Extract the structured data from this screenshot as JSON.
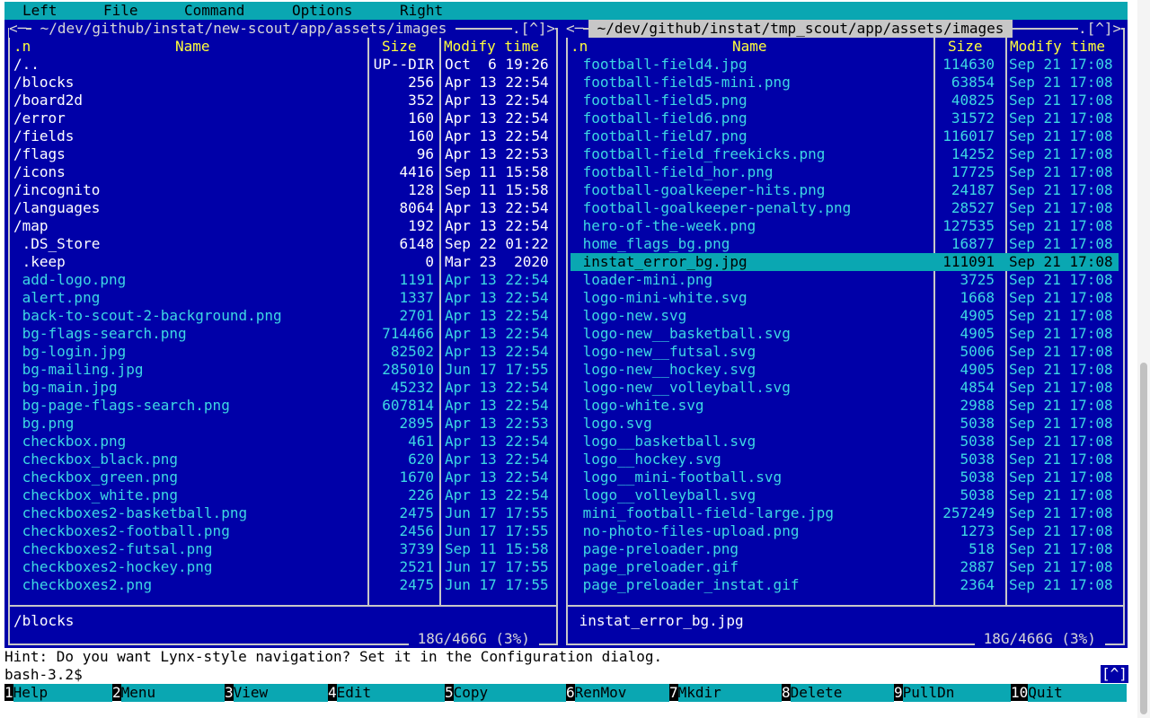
{
  "menu": [
    "Left",
    "File",
    "Command",
    "Options",
    "Right"
  ],
  "left_panel": {
    "title": " ~/dev/github/instat/new-scout/app/assets/images ",
    "corner_left": "<─",
    "corner_right": ".[^]>",
    "headers": {
      "n": ".n",
      "name": "Name",
      "size": "Size",
      "time": "Modify time"
    },
    "rows": [
      {
        "name": "/..",
        "size": "UP--DIR",
        "time": "Oct  6 19:26",
        "dir": true
      },
      {
        "name": "/blocks",
        "size": "256",
        "time": "Apr 13 22:54",
        "dir": true
      },
      {
        "name": "/board2d",
        "size": "352",
        "time": "Apr 13 22:54",
        "dir": true
      },
      {
        "name": "/error",
        "size": "160",
        "time": "Apr 13 22:54",
        "dir": true
      },
      {
        "name": "/fields",
        "size": "160",
        "time": "Apr 13 22:54",
        "dir": true
      },
      {
        "name": "/flags",
        "size": "96",
        "time": "Apr 13 22:53",
        "dir": true
      },
      {
        "name": "/icons",
        "size": "4416",
        "time": "Sep 11 15:58",
        "dir": true
      },
      {
        "name": "/incognito",
        "size": "128",
        "time": "Sep 11 15:58",
        "dir": true
      },
      {
        "name": "/languages",
        "size": "8064",
        "time": "Apr 13 22:54",
        "dir": true
      },
      {
        "name": "/map",
        "size": "192",
        "time": "Apr 13 22:54",
        "dir": true
      },
      {
        "name": " .DS_Store",
        "size": "6148",
        "time": "Sep 22 01:22",
        "dir": true
      },
      {
        "name": " .keep",
        "size": "0",
        "time": "Mar 23  2020",
        "dir": true
      },
      {
        "name": " add-logo.png",
        "size": "1191",
        "time": "Apr 13 22:54"
      },
      {
        "name": " alert.png",
        "size": "1337",
        "time": "Apr 13 22:54"
      },
      {
        "name": " back-to-scout-2-background.png",
        "size": "2701",
        "time": "Apr 13 22:54"
      },
      {
        "name": " bg-flags-search.png",
        "size": "714466",
        "time": "Apr 13 22:54"
      },
      {
        "name": " bg-login.jpg",
        "size": "82502",
        "time": "Apr 13 22:54"
      },
      {
        "name": " bg-mailing.jpg",
        "size": "285010",
        "time": "Jun 17 17:55"
      },
      {
        "name": " bg-main.jpg",
        "size": "45232",
        "time": "Apr 13 22:54"
      },
      {
        "name": " bg-page-flags-search.png",
        "size": "607814",
        "time": "Apr 13 22:54"
      },
      {
        "name": " bg.png",
        "size": "2895",
        "time": "Apr 13 22:53"
      },
      {
        "name": " checkbox.png",
        "size": "461",
        "time": "Apr 13 22:54"
      },
      {
        "name": " checkbox_black.png",
        "size": "620",
        "time": "Apr 13 22:54"
      },
      {
        "name": " checkbox_green.png",
        "size": "1670",
        "time": "Apr 13 22:54"
      },
      {
        "name": " checkbox_white.png",
        "size": "226",
        "time": "Apr 13 22:54"
      },
      {
        "name": " checkboxes2-basketball.png",
        "size": "2475",
        "time": "Jun 17 17:55"
      },
      {
        "name": " checkboxes2-football.png",
        "size": "2456",
        "time": "Jun 17 17:55"
      },
      {
        "name": " checkboxes2-futsal.png",
        "size": "3739",
        "time": "Sep 11 15:58"
      },
      {
        "name": " checkboxes2-hockey.png",
        "size": "2521",
        "time": "Jun 17 17:55"
      },
      {
        "name": " checkboxes2.png",
        "size": "2475",
        "time": "Jun 17 17:55"
      }
    ],
    "mini_status": "/blocks",
    "free_space": " 18G/466G (3%) "
  },
  "right_panel": {
    "title": " ~/dev/github/instat/tmp_scout/app/assets/images ",
    "corner_left": "<─",
    "corner_right": ".[^]>",
    "headers": {
      "n": ".n",
      "name": "Name",
      "size": "Size",
      "time": "Modify time"
    },
    "selected_index": 11,
    "rows": [
      {
        "name": " football-field4.jpg",
        "size": "114630",
        "time": "Sep 21 17:08"
      },
      {
        "name": " football-field5-mini.png",
        "size": "63854",
        "time": "Sep 21 17:08"
      },
      {
        "name": " football-field5.png",
        "size": "40825",
        "time": "Sep 21 17:08"
      },
      {
        "name": " football-field6.png",
        "size": "31572",
        "time": "Sep 21 17:08"
      },
      {
        "name": " football-field7.png",
        "size": "116017",
        "time": "Sep 21 17:08"
      },
      {
        "name": " football-field_freekicks.png",
        "size": "14252",
        "time": "Sep 21 17:08"
      },
      {
        "name": " football-field_hor.png",
        "size": "17725",
        "time": "Sep 21 17:08"
      },
      {
        "name": " football-goalkeeper-hits.png",
        "size": "24187",
        "time": "Sep 21 17:08"
      },
      {
        "name": " football-goalkeeper-penalty.png",
        "size": "28527",
        "time": "Sep 21 17:08"
      },
      {
        "name": " hero-of-the-week.png",
        "size": "127535",
        "time": "Sep 21 17:08"
      },
      {
        "name": " home_flags_bg.png",
        "size": "16877",
        "time": "Sep 21 17:08"
      },
      {
        "name": " instat_error_bg.jpg",
        "size": "111091",
        "time": "Sep 21 17:08"
      },
      {
        "name": " loader-mini.png",
        "size": "3725",
        "time": "Sep 21 17:08"
      },
      {
        "name": " logo-mini-white.svg",
        "size": "1668",
        "time": "Sep 21 17:08"
      },
      {
        "name": " logo-new.svg",
        "size": "4905",
        "time": "Sep 21 17:08"
      },
      {
        "name": " logo-new__basketball.svg",
        "size": "4905",
        "time": "Sep 21 17:08"
      },
      {
        "name": " logo-new__futsal.svg",
        "size": "5006",
        "time": "Sep 21 17:08"
      },
      {
        "name": " logo-new__hockey.svg",
        "size": "4905",
        "time": "Sep 21 17:08"
      },
      {
        "name": " logo-new__volleyball.svg",
        "size": "4854",
        "time": "Sep 21 17:08"
      },
      {
        "name": " logo-white.svg",
        "size": "2988",
        "time": "Sep 21 17:08"
      },
      {
        "name": " logo.svg",
        "size": "5038",
        "time": "Sep 21 17:08"
      },
      {
        "name": " logo__basketball.svg",
        "size": "5038",
        "time": "Sep 21 17:08"
      },
      {
        "name": " logo__hockey.svg",
        "size": "5038",
        "time": "Sep 21 17:08"
      },
      {
        "name": " logo__mini-football.svg",
        "size": "5038",
        "time": "Sep 21 17:08"
      },
      {
        "name": " logo__volleyball.svg",
        "size": "5038",
        "time": "Sep 21 17:08"
      },
      {
        "name": " mini_football-field-large.jpg",
        "size": "257249",
        "time": "Sep 21 17:08"
      },
      {
        "name": " no-photo-files-upload.png",
        "size": "1273",
        "time": "Sep 21 17:08"
      },
      {
        "name": " page-preloader.png",
        "size": "518",
        "time": "Sep 21 17:08"
      },
      {
        "name": " page_preloader.gif",
        "size": "2887",
        "time": "Sep 21 17:08"
      },
      {
        "name": " page_preloader_instat.gif",
        "size": "2364",
        "time": "Sep 21 17:08"
      }
    ],
    "mini_status": " instat_error_bg.jpg",
    "free_space": " 18G/466G (3%) "
  },
  "hint": "Hint: Do you want Lynx-style navigation? Set it in the Configuration dialog.",
  "prompt": "bash-3.2$",
  "prompt_button": "[^]",
  "fkeys": [
    {
      "num": "1",
      "label": "Help"
    },
    {
      "num": "2",
      "label": "Menu"
    },
    {
      "num": "3",
      "label": "View"
    },
    {
      "num": "4",
      "label": "Edit"
    },
    {
      "num": "5",
      "label": "Copy"
    },
    {
      "num": "6",
      "label": "RenMov"
    },
    {
      "num": "7",
      "label": "Mkdir"
    },
    {
      "num": "8",
      "label": "Delete"
    },
    {
      "num": "9",
      "label": "PullDn"
    },
    {
      "num": "10",
      "label": "Quit"
    }
  ],
  "colors": {
    "panel_bg": "#0000a8",
    "menu_bg": "#0aa7b2",
    "file_fg": "#3dd7e3",
    "dir_fg": "#ffffff",
    "header_fg": "#ffff3c"
  }
}
